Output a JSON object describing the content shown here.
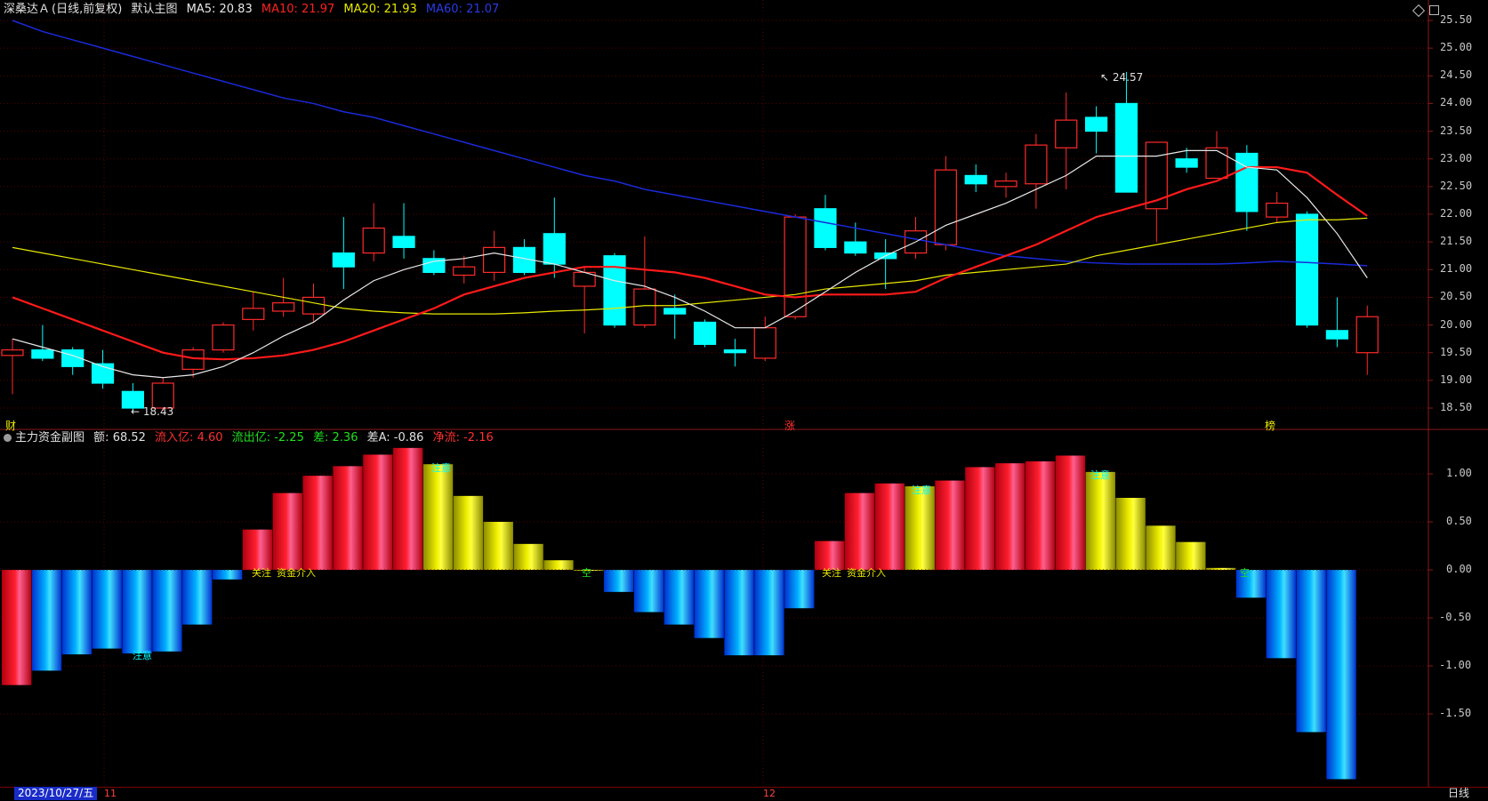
{
  "main_header": {
    "stock": "深桑达Ａ",
    "mode": "(日线,前复权)",
    "chart_name": "默认主图",
    "ma5_label": "MA5:",
    "ma5": "20.83",
    "ma10_label": "MA10:",
    "ma10": "21.97",
    "ma20_label": "MA20:",
    "ma20": "21.93",
    "ma60_label": "MA60:",
    "ma60": "21.07"
  },
  "sub_header": {
    "name": "主力资金副图",
    "amount_label": "额:",
    "amount": "68.52",
    "inflow_label": "流入亿:",
    "inflow": "4.60",
    "outflow_label": "流出亿:",
    "outflow": "-2.25",
    "diff_label": "差:",
    "diff": "2.36",
    "diffa_label": "差A:",
    "diffa": "-0.86",
    "net_label": "净流:",
    "net": "-2.16"
  },
  "price_axis": [
    "25.50",
    "25.00",
    "24.50",
    "24.00",
    "23.50",
    "23.00",
    "22.50",
    "22.00",
    "21.50",
    "21.00",
    "20.50",
    "20.00",
    "19.50",
    "19.00",
    "18.50"
  ],
  "sub_axis": [
    "1.00",
    "0.50",
    "0.00",
    "-0.50",
    "-1.00",
    "-1.50"
  ],
  "markers": {
    "high": "24.57",
    "low": "18.43",
    "cai": "财",
    "zhang": "涨",
    "bang": "榜"
  },
  "annotations": {
    "attention": "注意",
    "focus": "关注",
    "capital_in": "资金介入",
    "empty": "空"
  },
  "bottom": {
    "date": "2023/10/27/五",
    "m11": "11",
    "m12": "12",
    "period": "日线"
  },
  "icons": {
    "diamond": "diamond-icon",
    "square": "square-icon"
  },
  "colors": {
    "up": "#ff2a2a",
    "down": "#00ffff",
    "ma5": "#e8e8e8",
    "ma10": "#ff1a1a",
    "ma20": "#e8e800",
    "ma60": "#1a2ad8",
    "grid": "#5a0000"
  },
  "chart_data": [
    {
      "type": "candlestick",
      "title": "深桑达Ａ (日线,前复权)",
      "ylim": [
        18.3,
        25.6
      ],
      "candles": [
        {
          "o": 19.45,
          "h": 19.75,
          "l": 18.75,
          "c": 19.55
        },
        {
          "o": 19.55,
          "h": 20.0,
          "l": 19.35,
          "c": 19.4
        },
        {
          "o": 19.55,
          "h": 19.6,
          "l": 19.1,
          "c": 19.25
        },
        {
          "o": 19.3,
          "h": 19.55,
          "l": 18.85,
          "c": 18.95
        },
        {
          "o": 18.8,
          "h": 18.95,
          "l": 18.43,
          "c": 18.5
        },
        {
          "o": 18.5,
          "h": 19.05,
          "l": 18.45,
          "c": 18.95
        },
        {
          "o": 19.2,
          "h": 19.6,
          "l": 19.05,
          "c": 19.55
        },
        {
          "o": 19.55,
          "h": 20.05,
          "l": 19.5,
          "c": 20.0
        },
        {
          "o": 20.1,
          "h": 20.6,
          "l": 19.9,
          "c": 20.3
        },
        {
          "o": 20.25,
          "h": 20.85,
          "l": 20.15,
          "c": 20.4
        },
        {
          "o": 20.2,
          "h": 20.75,
          "l": 20.05,
          "c": 20.5
        },
        {
          "o": 21.3,
          "h": 21.95,
          "l": 20.65,
          "c": 21.05
        },
        {
          "o": 21.3,
          "h": 22.2,
          "l": 21.15,
          "c": 21.75
        },
        {
          "o": 21.6,
          "h": 22.2,
          "l": 21.2,
          "c": 21.4
        },
        {
          "o": 21.2,
          "h": 21.35,
          "l": 20.9,
          "c": 20.95
        },
        {
          "o": 20.9,
          "h": 21.25,
          "l": 20.75,
          "c": 21.05
        },
        {
          "o": 20.95,
          "h": 21.7,
          "l": 20.8,
          "c": 21.4
        },
        {
          "o": 21.4,
          "h": 21.55,
          "l": 20.9,
          "c": 20.95
        },
        {
          "o": 21.65,
          "h": 22.3,
          "l": 20.85,
          "c": 21.1
        },
        {
          "o": 20.7,
          "h": 21.05,
          "l": 19.85,
          "c": 20.95
        },
        {
          "o": 21.25,
          "h": 21.3,
          "l": 19.95,
          "c": 20.0
        },
        {
          "o": 20.0,
          "h": 21.6,
          "l": 19.95,
          "c": 20.65
        },
        {
          "o": 20.3,
          "h": 20.55,
          "l": 19.75,
          "c": 20.2
        },
        {
          "o": 20.05,
          "h": 20.1,
          "l": 19.6,
          "c": 19.65
        },
        {
          "o": 19.55,
          "h": 19.75,
          "l": 19.25,
          "c": 19.5
        },
        {
          "o": 19.4,
          "h": 20.15,
          "l": 19.35,
          "c": 19.95
        },
        {
          "o": 20.15,
          "h": 22.0,
          "l": 20.1,
          "c": 21.95
        },
        {
          "o": 22.1,
          "h": 22.35,
          "l": 21.35,
          "c": 21.4
        },
        {
          "o": 21.5,
          "h": 21.85,
          "l": 21.25,
          "c": 21.3
        },
        {
          "o": 21.3,
          "h": 21.55,
          "l": 20.65,
          "c": 21.2
        },
        {
          "o": 21.3,
          "h": 21.95,
          "l": 21.2,
          "c": 21.7
        },
        {
          "o": 21.45,
          "h": 23.05,
          "l": 21.35,
          "c": 22.8
        },
        {
          "o": 22.7,
          "h": 22.9,
          "l": 22.4,
          "c": 22.55
        },
        {
          "o": 22.5,
          "h": 22.75,
          "l": 22.3,
          "c": 22.6
        },
        {
          "o": 22.55,
          "h": 23.45,
          "l": 22.1,
          "c": 23.25
        },
        {
          "o": 23.2,
          "h": 24.2,
          "l": 22.45,
          "c": 23.7
        },
        {
          "o": 23.75,
          "h": 23.95,
          "l": 23.1,
          "c": 23.5
        },
        {
          "o": 24.0,
          "h": 24.57,
          "l": 22.4,
          "c": 22.4
        },
        {
          "o": 22.1,
          "h": 23.3,
          "l": 21.5,
          "c": 23.3
        },
        {
          "o": 23.0,
          "h": 23.2,
          "l": 22.75,
          "c": 22.85
        },
        {
          "o": 22.65,
          "h": 23.5,
          "l": 22.65,
          "c": 23.2
        },
        {
          "o": 23.1,
          "h": 23.25,
          "l": 21.7,
          "c": 22.05
        },
        {
          "o": 21.95,
          "h": 22.4,
          "l": 21.85,
          "c": 22.2
        },
        {
          "o": 22.0,
          "h": 22.05,
          "l": 19.95,
          "c": 20.0
        },
        {
          "o": 19.9,
          "h": 20.5,
          "l": 19.6,
          "c": 19.75
        },
        {
          "o": 19.5,
          "h": 20.35,
          "l": 19.1,
          "c": 20.15
        }
      ],
      "ma5": [
        19.75,
        19.6,
        19.45,
        19.25,
        19.1,
        19.05,
        19.1,
        19.25,
        19.5,
        19.8,
        20.05,
        20.45,
        20.8,
        21.0,
        21.15,
        21.2,
        21.3,
        21.2,
        21.1,
        20.95,
        20.8,
        20.7,
        20.5,
        20.25,
        19.95,
        19.95,
        20.25,
        20.6,
        20.95,
        21.25,
        21.5,
        21.8,
        22.0,
        22.2,
        22.45,
        22.7,
        23.05,
        23.05,
        23.05,
        23.15,
        23.15,
        22.85,
        22.8,
        22.3,
        21.65,
        20.85
      ],
      "ma10": [
        20.5,
        20.3,
        20.1,
        19.9,
        19.7,
        19.5,
        19.4,
        19.38,
        19.4,
        19.45,
        19.55,
        19.7,
        19.9,
        20.1,
        20.3,
        20.55,
        20.7,
        20.85,
        20.95,
        21.05,
        21.05,
        21.0,
        20.95,
        20.85,
        20.7,
        20.55,
        20.5,
        20.55,
        20.55,
        20.55,
        20.6,
        20.85,
        21.05,
        21.25,
        21.45,
        21.7,
        21.95,
        22.1,
        22.25,
        22.45,
        22.6,
        22.85,
        22.85,
        22.75,
        22.35,
        21.97
      ],
      "ma20": [
        21.4,
        21.3,
        21.2,
        21.1,
        21.0,
        20.9,
        20.8,
        20.7,
        20.6,
        20.5,
        20.4,
        20.3,
        20.25,
        20.22,
        20.2,
        20.2,
        20.2,
        20.22,
        20.25,
        20.27,
        20.3,
        20.35,
        20.35,
        20.4,
        20.45,
        20.5,
        20.55,
        20.65,
        20.7,
        20.75,
        20.8,
        20.9,
        20.95,
        21.0,
        21.05,
        21.1,
        21.25,
        21.35,
        21.45,
        21.55,
        21.65,
        21.75,
        21.85,
        21.9,
        21.9,
        21.93
      ],
      "ma60": [
        25.5,
        25.3,
        25.15,
        25.0,
        24.85,
        24.7,
        24.55,
        24.4,
        24.25,
        24.1,
        24.0,
        23.85,
        23.75,
        23.6,
        23.45,
        23.3,
        23.15,
        23.0,
        22.85,
        22.7,
        22.6,
        22.45,
        22.35,
        22.25,
        22.15,
        22.05,
        21.95,
        21.85,
        21.75,
        21.65,
        21.55,
        21.45,
        21.35,
        21.25,
        21.2,
        21.15,
        21.12,
        21.1,
        21.1,
        21.1,
        21.1,
        21.12,
        21.15,
        21.13,
        21.1,
        21.07
      ]
    },
    {
      "type": "bar",
      "title": "主力资金副图",
      "ylim": [
        -2.2,
        1.35
      ],
      "values": [
        -1.2,
        -1.05,
        -0.88,
        -0.82,
        -0.87,
        -0.85,
        -0.57,
        -0.1,
        0.42,
        0.8,
        0.98,
        1.08,
        1.2,
        1.27,
        1.1,
        0.77,
        0.5,
        0.27,
        0.1,
        0.0,
        -0.23,
        -0.44,
        -0.57,
        -0.71,
        -0.89,
        -0.89,
        -0.4,
        0.3,
        0.8,
        0.9,
        0.87,
        0.93,
        1.07,
        1.11,
        1.13,
        1.19,
        1.02,
        0.75,
        0.46,
        0.29,
        0.02,
        -0.29,
        -0.92,
        -1.69,
        -2.18
      ]
    }
  ]
}
